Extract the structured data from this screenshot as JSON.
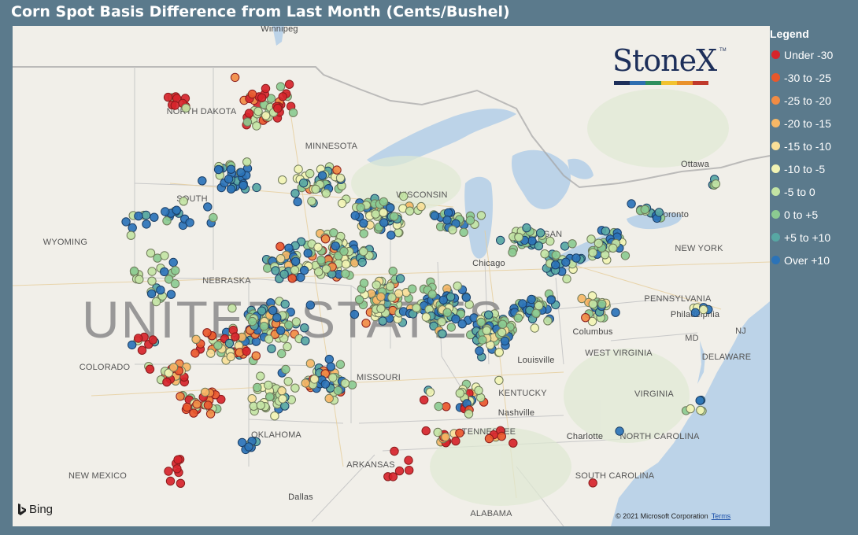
{
  "title": "Corn Spot Basis Difference from Last Month (Cents/Bushel)",
  "logo": {
    "text": "StoneX",
    "tm": "TM",
    "bar_colors": [
      "#1d2f5a",
      "#2e6fb0",
      "#2e8f5e",
      "#f2c230",
      "#e9912a",
      "#c0392b"
    ]
  },
  "legend": {
    "title": "Legend",
    "items": [
      {
        "label": "Under -30",
        "color": "#d7242b"
      },
      {
        "label": "-30 to -25",
        "color": "#e9572b"
      },
      {
        "label": "-25 to -20",
        "color": "#f28c44"
      },
      {
        "label": "-20 to -15",
        "color": "#f6b766"
      },
      {
        "label": "-15 to -10",
        "color": "#f9df98"
      },
      {
        "label": "-10 to -5",
        "color": "#f2f4b4"
      },
      {
        "label": "-5 to 0",
        "color": "#c3e4a4"
      },
      {
        "label": "0 to +5",
        "color": "#8ccb91"
      },
      {
        "label": "+5 to +10",
        "color": "#57a7a3"
      },
      {
        "label": "Over +10",
        "color": "#2b73b8"
      }
    ]
  },
  "map": {
    "country_label": "UNITED STATES",
    "labels": [
      {
        "text": "Winnipeg",
        "kind": "city"
      },
      {
        "text": "NORTH DAKOTA",
        "kind": "state"
      },
      {
        "text": "MINNESOTA",
        "kind": "state"
      },
      {
        "text": "SOUTH",
        "kind": "state"
      },
      {
        "text": "WYOMING",
        "kind": "state"
      },
      {
        "text": "WISCONSIN",
        "kind": "state"
      },
      {
        "text": "MICHIGAN",
        "kind": "state"
      },
      {
        "text": "Chicago",
        "kind": "city"
      },
      {
        "text": "Ottawa",
        "kind": "city"
      },
      {
        "text": "Toronto",
        "kind": "city"
      },
      {
        "text": "NEW YORK",
        "kind": "state"
      },
      {
        "text": "NEBRASKA",
        "kind": "state"
      },
      {
        "text": "PENNSYLVANIA",
        "kind": "state"
      },
      {
        "text": "Philadelphia",
        "kind": "city"
      },
      {
        "text": "NJ",
        "kind": "state"
      },
      {
        "text": "MD",
        "kind": "state"
      },
      {
        "text": "DELAWARE",
        "kind": "state"
      },
      {
        "text": "COLORADO",
        "kind": "state"
      },
      {
        "text": "Columbus",
        "kind": "city"
      },
      {
        "text": "WEST VIRGINIA",
        "kind": "state"
      },
      {
        "text": "Louisville",
        "kind": "city"
      },
      {
        "text": "MISSOURI",
        "kind": "state"
      },
      {
        "text": "KENTUCKY",
        "kind": "state"
      },
      {
        "text": "VIRGINIA",
        "kind": "state"
      },
      {
        "text": "Nashville",
        "kind": "city"
      },
      {
        "text": "TENNESSEE",
        "kind": "state"
      },
      {
        "text": "OKLAHOMA",
        "kind": "state"
      },
      {
        "text": "Charlotte",
        "kind": "city"
      },
      {
        "text": "NORTH CAROLINA",
        "kind": "state"
      },
      {
        "text": "NEW MEXICO",
        "kind": "state"
      },
      {
        "text": "ARKANSAS",
        "kind": "state"
      },
      {
        "text": "SOUTH CAROLINA",
        "kind": "state"
      },
      {
        "text": "Dallas",
        "kind": "city"
      },
      {
        "text": "ALABAMA",
        "kind": "state"
      }
    ]
  },
  "attribution": {
    "bing": "Bing",
    "copyright": "© 2021 Microsoft Corporation",
    "terms": "Terms"
  }
}
